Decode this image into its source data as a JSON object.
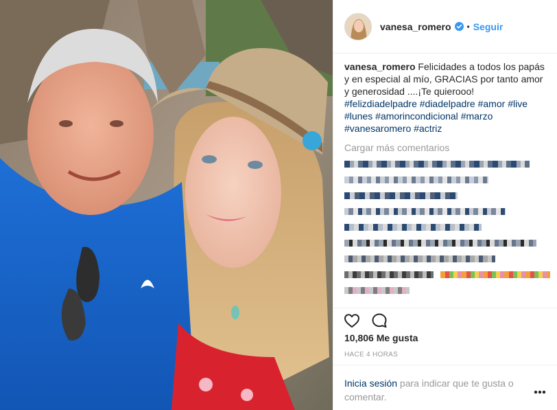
{
  "post": {
    "username": "vanesa_romero",
    "follow_label": "Seguir",
    "separator": "•",
    "caption_text": "Felicidades a todos los papás y en especial al mío, GRACIAS por tanto amor y generosidad ....¡Te quierooo!",
    "hashtags": [
      "#felizdiadelpadre",
      "#diadelpadre",
      "#amor",
      "#live",
      "#lunes",
      "#amorincondicional",
      "#marzo",
      "#vanesaromero",
      "#actriz"
    ],
    "load_more_comments": "Cargar más comentarios",
    "likes": "10,806 Me gusta",
    "timestamp": "HACE 4 HORAS",
    "login_link": "Inicia sesión",
    "login_text": " para indicar que te gusta o comentar.",
    "icons": {
      "verified": "verified-badge-icon",
      "like": "heart-icon",
      "comment": "comment-bubble-icon",
      "more": "more-options-icon"
    },
    "colors": {
      "link_blue": "#3897f0",
      "hashtag_navy": "#003569",
      "muted_gray": "#999999",
      "text": "#262626",
      "verified_blue": "#3897f0"
    }
  }
}
